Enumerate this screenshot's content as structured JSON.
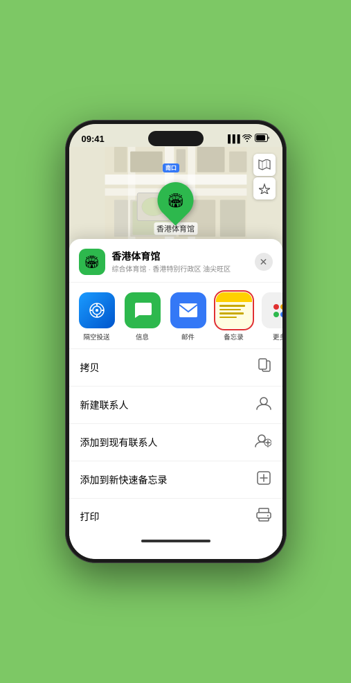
{
  "status_bar": {
    "time": "09:41",
    "location_icon": "▶",
    "signal_bars": "▐▐▐",
    "wifi": "wifi",
    "battery": "🔋"
  },
  "map": {
    "exit_label": "南口",
    "location_name": "香港体育馆",
    "controls": {
      "map_icon": "🗺",
      "compass_icon": "⊕"
    }
  },
  "bottom_sheet": {
    "venue_icon": "🏟",
    "venue_name": "香港体育馆",
    "venue_desc": "综合体育馆 · 香港特别行政区 油尖旺区",
    "close_label": "✕",
    "share_items": [
      {
        "id": "airdrop",
        "label": "隔空投送",
        "icon": "📡"
      },
      {
        "id": "message",
        "label": "信息",
        "icon": "💬"
      },
      {
        "id": "mail",
        "label": "邮件",
        "icon": "✉"
      },
      {
        "id": "notes",
        "label": "备忘录",
        "icon": "notes"
      }
    ],
    "more_label": "更多",
    "more_colors": [
      "#e03030",
      "#e8a000",
      "#2db84d",
      "#3478f6"
    ],
    "actions": [
      {
        "id": "copy",
        "label": "拷贝",
        "icon": "⎘"
      },
      {
        "id": "new-contact",
        "label": "新建联系人",
        "icon": "👤"
      },
      {
        "id": "add-to-contact",
        "label": "添加到现有联系人",
        "icon": "👤+"
      },
      {
        "id": "add-to-notes",
        "label": "添加到新快速备忘录",
        "icon": "⊞"
      },
      {
        "id": "print",
        "label": "打印",
        "icon": "🖨"
      }
    ]
  }
}
